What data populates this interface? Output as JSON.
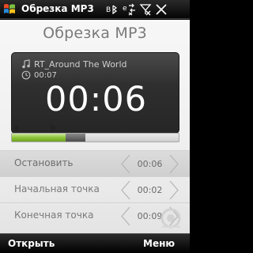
{
  "statusbar": {
    "title": "Обрезка MP3",
    "icons": [
      "windows-start-icon",
      "bluetooth-icon",
      "data-connection-icon",
      "signal-off-icon",
      "close-icon"
    ]
  },
  "main": {
    "heading": "Обрезка MP3",
    "player": {
      "track_name": "RT_Around The World",
      "duration": "00:07",
      "current_time": "00:06"
    },
    "progress": {
      "played_fraction": 0.32,
      "dark_start_fraction": 0.32,
      "dark_end_fraction": 0.44
    },
    "rows": [
      {
        "label": "Остановить",
        "value": "00:06"
      },
      {
        "label": "Начальная точка",
        "value": "00:02"
      },
      {
        "label": "Конечная точка",
        "value": "00:09"
      }
    ]
  },
  "softkeys": {
    "left": "Открыть",
    "right": "Меню"
  },
  "colors": {
    "progress_green": "#8ec43a",
    "player_bg": "#2f2f2f",
    "panel_bg": "#efefef"
  }
}
